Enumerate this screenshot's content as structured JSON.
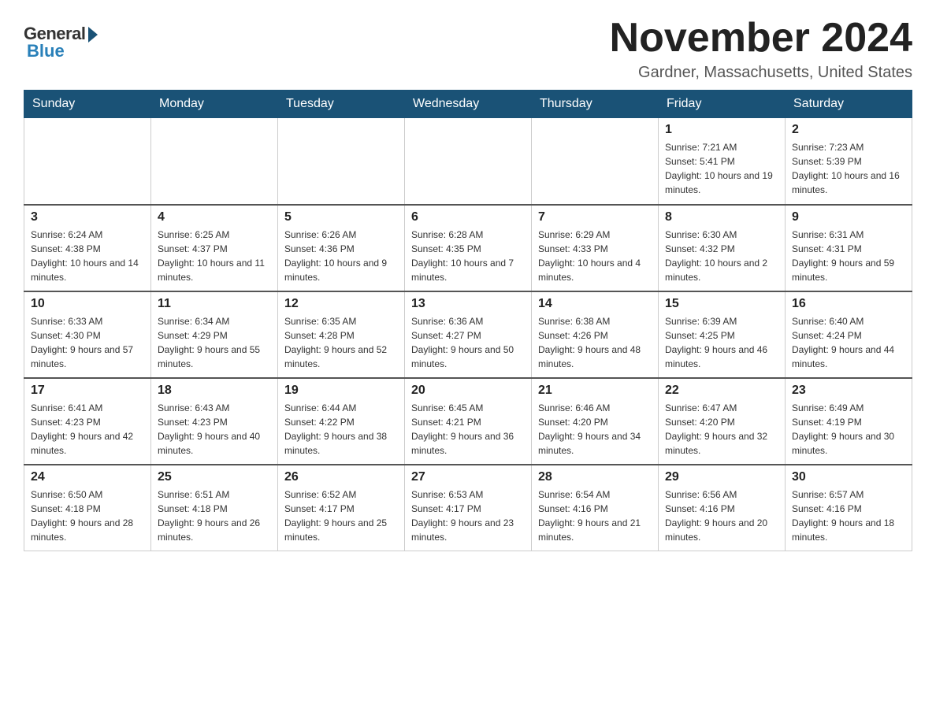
{
  "header": {
    "logo_general": "General",
    "logo_blue": "Blue",
    "month_title": "November 2024",
    "location": "Gardner, Massachusetts, United States"
  },
  "calendar": {
    "days_of_week": [
      "Sunday",
      "Monday",
      "Tuesday",
      "Wednesday",
      "Thursday",
      "Friday",
      "Saturday"
    ],
    "weeks": [
      [
        {
          "day": "",
          "info": ""
        },
        {
          "day": "",
          "info": ""
        },
        {
          "day": "",
          "info": ""
        },
        {
          "day": "",
          "info": ""
        },
        {
          "day": "",
          "info": ""
        },
        {
          "day": "1",
          "info": "Sunrise: 7:21 AM\nSunset: 5:41 PM\nDaylight: 10 hours and 19 minutes."
        },
        {
          "day": "2",
          "info": "Sunrise: 7:23 AM\nSunset: 5:39 PM\nDaylight: 10 hours and 16 minutes."
        }
      ],
      [
        {
          "day": "3",
          "info": "Sunrise: 6:24 AM\nSunset: 4:38 PM\nDaylight: 10 hours and 14 minutes."
        },
        {
          "day": "4",
          "info": "Sunrise: 6:25 AM\nSunset: 4:37 PM\nDaylight: 10 hours and 11 minutes."
        },
        {
          "day": "5",
          "info": "Sunrise: 6:26 AM\nSunset: 4:36 PM\nDaylight: 10 hours and 9 minutes."
        },
        {
          "day": "6",
          "info": "Sunrise: 6:28 AM\nSunset: 4:35 PM\nDaylight: 10 hours and 7 minutes."
        },
        {
          "day": "7",
          "info": "Sunrise: 6:29 AM\nSunset: 4:33 PM\nDaylight: 10 hours and 4 minutes."
        },
        {
          "day": "8",
          "info": "Sunrise: 6:30 AM\nSunset: 4:32 PM\nDaylight: 10 hours and 2 minutes."
        },
        {
          "day": "9",
          "info": "Sunrise: 6:31 AM\nSunset: 4:31 PM\nDaylight: 9 hours and 59 minutes."
        }
      ],
      [
        {
          "day": "10",
          "info": "Sunrise: 6:33 AM\nSunset: 4:30 PM\nDaylight: 9 hours and 57 minutes."
        },
        {
          "day": "11",
          "info": "Sunrise: 6:34 AM\nSunset: 4:29 PM\nDaylight: 9 hours and 55 minutes."
        },
        {
          "day": "12",
          "info": "Sunrise: 6:35 AM\nSunset: 4:28 PM\nDaylight: 9 hours and 52 minutes."
        },
        {
          "day": "13",
          "info": "Sunrise: 6:36 AM\nSunset: 4:27 PM\nDaylight: 9 hours and 50 minutes."
        },
        {
          "day": "14",
          "info": "Sunrise: 6:38 AM\nSunset: 4:26 PM\nDaylight: 9 hours and 48 minutes."
        },
        {
          "day": "15",
          "info": "Sunrise: 6:39 AM\nSunset: 4:25 PM\nDaylight: 9 hours and 46 minutes."
        },
        {
          "day": "16",
          "info": "Sunrise: 6:40 AM\nSunset: 4:24 PM\nDaylight: 9 hours and 44 minutes."
        }
      ],
      [
        {
          "day": "17",
          "info": "Sunrise: 6:41 AM\nSunset: 4:23 PM\nDaylight: 9 hours and 42 minutes."
        },
        {
          "day": "18",
          "info": "Sunrise: 6:43 AM\nSunset: 4:23 PM\nDaylight: 9 hours and 40 minutes."
        },
        {
          "day": "19",
          "info": "Sunrise: 6:44 AM\nSunset: 4:22 PM\nDaylight: 9 hours and 38 minutes."
        },
        {
          "day": "20",
          "info": "Sunrise: 6:45 AM\nSunset: 4:21 PM\nDaylight: 9 hours and 36 minutes."
        },
        {
          "day": "21",
          "info": "Sunrise: 6:46 AM\nSunset: 4:20 PM\nDaylight: 9 hours and 34 minutes."
        },
        {
          "day": "22",
          "info": "Sunrise: 6:47 AM\nSunset: 4:20 PM\nDaylight: 9 hours and 32 minutes."
        },
        {
          "day": "23",
          "info": "Sunrise: 6:49 AM\nSunset: 4:19 PM\nDaylight: 9 hours and 30 minutes."
        }
      ],
      [
        {
          "day": "24",
          "info": "Sunrise: 6:50 AM\nSunset: 4:18 PM\nDaylight: 9 hours and 28 minutes."
        },
        {
          "day": "25",
          "info": "Sunrise: 6:51 AM\nSunset: 4:18 PM\nDaylight: 9 hours and 26 minutes."
        },
        {
          "day": "26",
          "info": "Sunrise: 6:52 AM\nSunset: 4:17 PM\nDaylight: 9 hours and 25 minutes."
        },
        {
          "day": "27",
          "info": "Sunrise: 6:53 AM\nSunset: 4:17 PM\nDaylight: 9 hours and 23 minutes."
        },
        {
          "day": "28",
          "info": "Sunrise: 6:54 AM\nSunset: 4:16 PM\nDaylight: 9 hours and 21 minutes."
        },
        {
          "day": "29",
          "info": "Sunrise: 6:56 AM\nSunset: 4:16 PM\nDaylight: 9 hours and 20 minutes."
        },
        {
          "day": "30",
          "info": "Sunrise: 6:57 AM\nSunset: 4:16 PM\nDaylight: 9 hours and 18 minutes."
        }
      ]
    ]
  }
}
